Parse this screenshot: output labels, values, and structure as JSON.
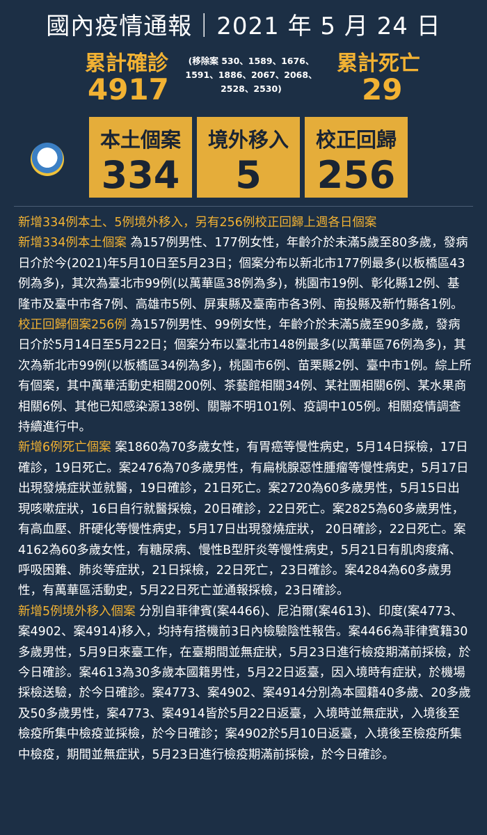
{
  "title": "國內疫情通報｜2021 年 5 月 24 日",
  "cumulative_confirmed": {
    "label": "累計確診",
    "value": "4917"
  },
  "excluded_cases": "(移除案 530、1589、1676、1591、1886、2067、2068、2528、2530)",
  "cumulative_deaths": {
    "label": "累計死亡",
    "value": "29"
  },
  "boxes": [
    {
      "label": "本土個案",
      "value": "334"
    },
    {
      "label": "境外移入",
      "value": "5"
    },
    {
      "label": "校正回歸",
      "value": "256"
    }
  ],
  "headline": "新增334例本土、5例境外移入，另有256例校正回歸上週各日個案",
  "sections": [
    {
      "heading": "新增334例本土個案",
      "text": " 為157例男性、177例女性，年齡介於未滿5歲至80多歲，發病日介於今(2021)年5月10日至5月23日；個案分布以新北市177例最多(以板橋區43例為多)，其次為臺北市99例(以萬華區38例為多)，桃園市19例、彰化縣12例、基隆市及臺中市各7例、高雄市5例、屏東縣及臺南市各3例、南投縣及新竹縣各1例。"
    },
    {
      "heading": "校正回歸個案256例",
      "text": " 為157例男性、99例女性，年齡介於未滿5歲至90多歲，發病日介於5月14日至5月22日；個案分布以臺北市148例最多(以萬華區76例為多)，其次為新北市99例(以板橋區34例為多)，桃園市6例、苗栗縣2例、臺中市1例。綜上所有個案，其中萬華活動史相關200例、茶藝館相關34例、某社團相關6例、某水果商相關6例、其他已知感染源138例、關聯不明101例、疫調中105例。相關疫情調查持續進行中。"
    },
    {
      "heading": "新增6例死亡個案",
      "text": " 案1860為70多歲女性，有胃癌等慢性病史，5月14日採檢，17日確診，19日死亡。案2476為70多歲男性，有扁桃腺惡性腫瘤等慢性病史，5月17日出現發燒症狀並就醫，19日確診，21日死亡。案2720為60多歲男性，5月15日出現咳嗽症狀，16日自行就醫採檢，20日確診，22日死亡。案2825為60多歲男性，有高血壓、肝硬化等慢性病史，5月17日出現發燒症狀， 20日確診，22日死亡。案4162為60多歲女性，有糖尿病、慢性B型肝炎等慢性病史，5月21日有肌肉痠痛、呼吸困難、肺炎等症狀，21日採檢，22日死亡，23日確診。案4284為60多歲男性，有萬華區活動史，5月22日死亡並通報採檢，23日確診。"
    },
    {
      "heading": "新增5例境外移入個案",
      "text": " 分別自菲律賓(案4466)、尼泊爾(案4613)、印度(案4773、案4902、案4914)移入，均持有搭機前3日內檢驗陰性報告。案4466為菲律賓籍30多歲男性，5月9日來臺工作，在臺期間並無症狀，5月23日進行檢疫期滿前採檢，於今日確診。案4613為30多歲本國籍男性，5月22日返臺，因入境時有症狀，於機場採檢送驗，於今日確診。案4773、案4902、案4914分別為本國籍40多歲、20多歲及50多歲男性，案4773、案4914皆於5月22日返臺，入境時並無症狀，入境後至檢疫所集中檢疫並採檢，於今日確診；案4902於5月10日返臺，入境後至檢疫所集中檢疫，期間並無症狀，5月23日進行檢疫期滿前採檢，於今日確診。"
    }
  ],
  "colors": {
    "background": "#1c2f45",
    "accent": "#f2b233",
    "box": "#e5ad3a"
  },
  "logo_icon": "cdc-emblem-icon"
}
